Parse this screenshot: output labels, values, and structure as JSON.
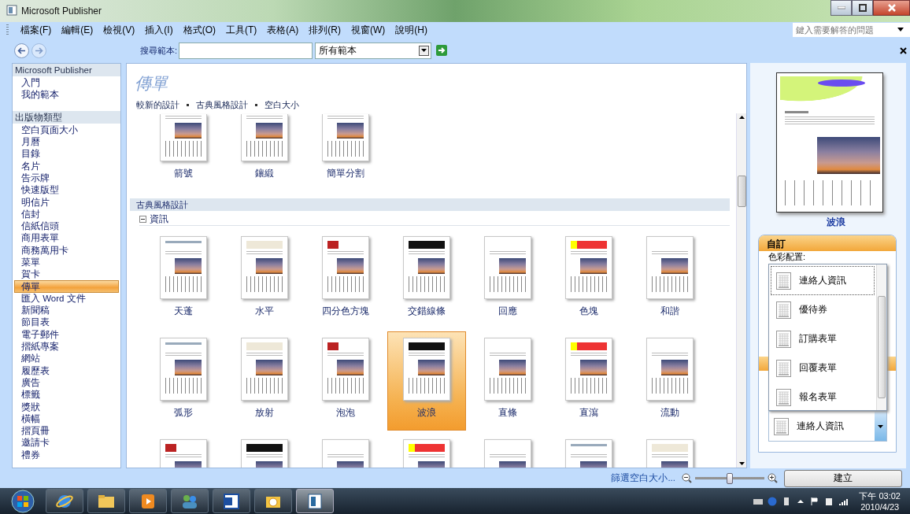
{
  "window": {
    "title": "Microsoft Publisher"
  },
  "menu": [
    {
      "label": "檔案(F)"
    },
    {
      "label": "編輯(E)"
    },
    {
      "label": "檢視(V)"
    },
    {
      "label": "插入(I)"
    },
    {
      "label": "格式(O)"
    },
    {
      "label": "工具(T)"
    },
    {
      "label": "表格(A)"
    },
    {
      "label": "排列(R)"
    },
    {
      "label": "視窗(W)"
    },
    {
      "label": "說明(H)"
    }
  ],
  "help_box": {
    "placeholder": "鍵入需要解答的問題"
  },
  "nav": {
    "back": {
      "disabled": false
    },
    "forward": {
      "disabled": true
    }
  },
  "search": {
    "label": "搜尋範本:",
    "scope": "所有範本"
  },
  "sidebar": {
    "sections": [
      {
        "title": "Microsoft Publisher",
        "items": [
          {
            "label": "入門",
            "selected": false
          },
          {
            "label": "我的範本",
            "selected": false
          }
        ]
      },
      {
        "title": "出版物類型",
        "items": [
          {
            "label": "空白頁面大小",
            "selected": false
          },
          {
            "label": "月曆",
            "selected": false
          },
          {
            "label": "目錄",
            "selected": false
          },
          {
            "label": "名片",
            "selected": false
          },
          {
            "label": "告示牌",
            "selected": false
          },
          {
            "label": "快速版型",
            "selected": false
          },
          {
            "label": "明信片",
            "selected": false
          },
          {
            "label": "信封",
            "selected": false
          },
          {
            "label": "信紙信頭",
            "selected": false
          },
          {
            "label": "商用表單",
            "selected": false
          },
          {
            "label": "商務萬用卡",
            "selected": false
          },
          {
            "label": "菜單",
            "selected": false
          },
          {
            "label": "賀卡",
            "selected": false
          },
          {
            "label": "傳單",
            "selected": true
          },
          {
            "label": "匯入 Word 文件",
            "selected": false
          },
          {
            "label": "新聞稿",
            "selected": false
          },
          {
            "label": "節目表",
            "selected": false
          },
          {
            "label": "電子郵件",
            "selected": false
          },
          {
            "label": "摺紙專案",
            "selected": false
          },
          {
            "label": "網站",
            "selected": false
          },
          {
            "label": "履歷表",
            "selected": false
          },
          {
            "label": "廣告",
            "selected": false
          },
          {
            "label": "標籤",
            "selected": false
          },
          {
            "label": "獎狀",
            "selected": false
          },
          {
            "label": "橫幅",
            "selected": false
          },
          {
            "label": "摺頁冊",
            "selected": false
          },
          {
            "label": "邀請卡",
            "selected": false
          },
          {
            "label": "禮券",
            "selected": false
          }
        ]
      }
    ]
  },
  "gallery": {
    "title": "傳單",
    "links": [
      "較新的設計",
      "古典風格設計",
      "空白大小"
    ],
    "top_row": [
      {
        "label": "箭號",
        "selected": false
      },
      {
        "label": "鑲緞",
        "selected": false
      },
      {
        "label": "簡單分割",
        "selected": false
      }
    ],
    "section": "古典風格設計",
    "group": {
      "label": "資訊",
      "expanded": true
    },
    "rows": [
      [
        {
          "label": "天蓬",
          "selected": false
        },
        {
          "label": "水平",
          "selected": false
        },
        {
          "label": "四分色方塊",
          "selected": false
        },
        {
          "label": "交錯線條",
          "selected": false
        },
        {
          "label": "回應",
          "selected": false
        },
        {
          "label": "色塊",
          "selected": false
        },
        {
          "label": "和諧",
          "selected": false
        }
      ],
      [
        {
          "label": "弧形",
          "selected": false
        },
        {
          "label": "放射",
          "selected": false
        },
        {
          "label": "泡泡",
          "selected": false
        },
        {
          "label": "波浪",
          "selected": true
        },
        {
          "label": "直條",
          "selected": false
        },
        {
          "label": "直瀉",
          "selected": false
        },
        {
          "label": "流動",
          "selected": false
        }
      ]
    ],
    "partial_row": [
      {
        "selected": false
      },
      {
        "selected": false
      },
      {
        "selected": false
      },
      {
        "selected": false
      },
      {
        "selected": false
      },
      {
        "selected": false
      },
      {
        "selected": false
      }
    ]
  },
  "preview": {
    "name": "波浪"
  },
  "customize": {
    "title": "自訂",
    "color_scheme_label": "色彩配置:",
    "options": [
      {
        "label": "連絡人資訊",
        "selected": true
      },
      {
        "label": "優待券",
        "selected": false
      },
      {
        "label": "訂購表單",
        "selected": false
      },
      {
        "label": "回覆表單",
        "selected": false
      },
      {
        "label": "報名表單",
        "selected": false
      }
    ],
    "value": "連絡人資訊"
  },
  "footer": {
    "filter_link": "篩選空白大小...",
    "zoom": {
      "level": 0.5
    },
    "create_button": "建立"
  },
  "taskbar": {
    "apps": [
      {
        "kind": "ie",
        "active": false
      },
      {
        "kind": "folder",
        "active": false
      },
      {
        "kind": "media",
        "active": false
      },
      {
        "kind": "people",
        "active": false
      },
      {
        "kind": "word",
        "active": false
      },
      {
        "kind": "outlook",
        "active": false
      },
      {
        "kind": "publisher",
        "active": true
      }
    ],
    "time": "下午 03:02",
    "date": "2010/4/23"
  }
}
